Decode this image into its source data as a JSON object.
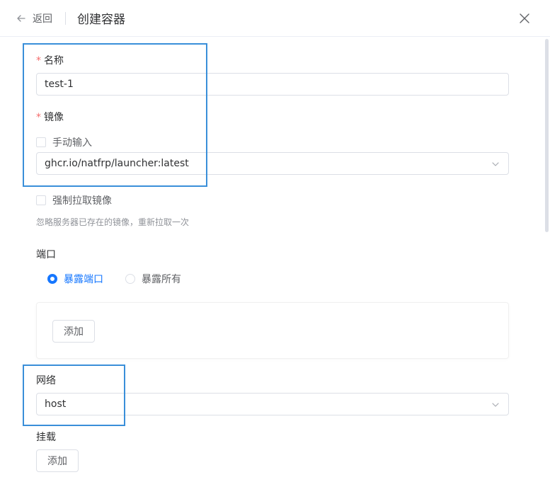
{
  "header": {
    "back_label": "返回",
    "title": "创建容器"
  },
  "form": {
    "name": {
      "label": "名称",
      "required_mark": "*",
      "value": "test-1"
    },
    "image": {
      "label": "镜像",
      "required_mark": "*",
      "manual_input_label": "手动输入",
      "manual_input_checked": false,
      "selected": "ghcr.io/natfrp/launcher:latest"
    },
    "force_pull": {
      "label": "强制拉取镜像",
      "checked": false,
      "hint": "忽略服务器已存在的镜像，重新拉取一次"
    },
    "ports": {
      "label": "端口",
      "options": [
        {
          "label": "暴露端口",
          "selected": true
        },
        {
          "label": "暴露所有",
          "selected": false
        }
      ],
      "add_label": "添加"
    },
    "network": {
      "label": "网络",
      "selected": "host"
    },
    "mounts": {
      "label": "挂载",
      "add_label": "添加"
    }
  },
  "colors": {
    "accent": "#1677ff",
    "required": "#f56c6c",
    "highlight_box": "#3a8fd9"
  },
  "icons": {
    "back": "arrow-left-icon",
    "close": "close-icon",
    "select": "chevron-down-icon"
  }
}
